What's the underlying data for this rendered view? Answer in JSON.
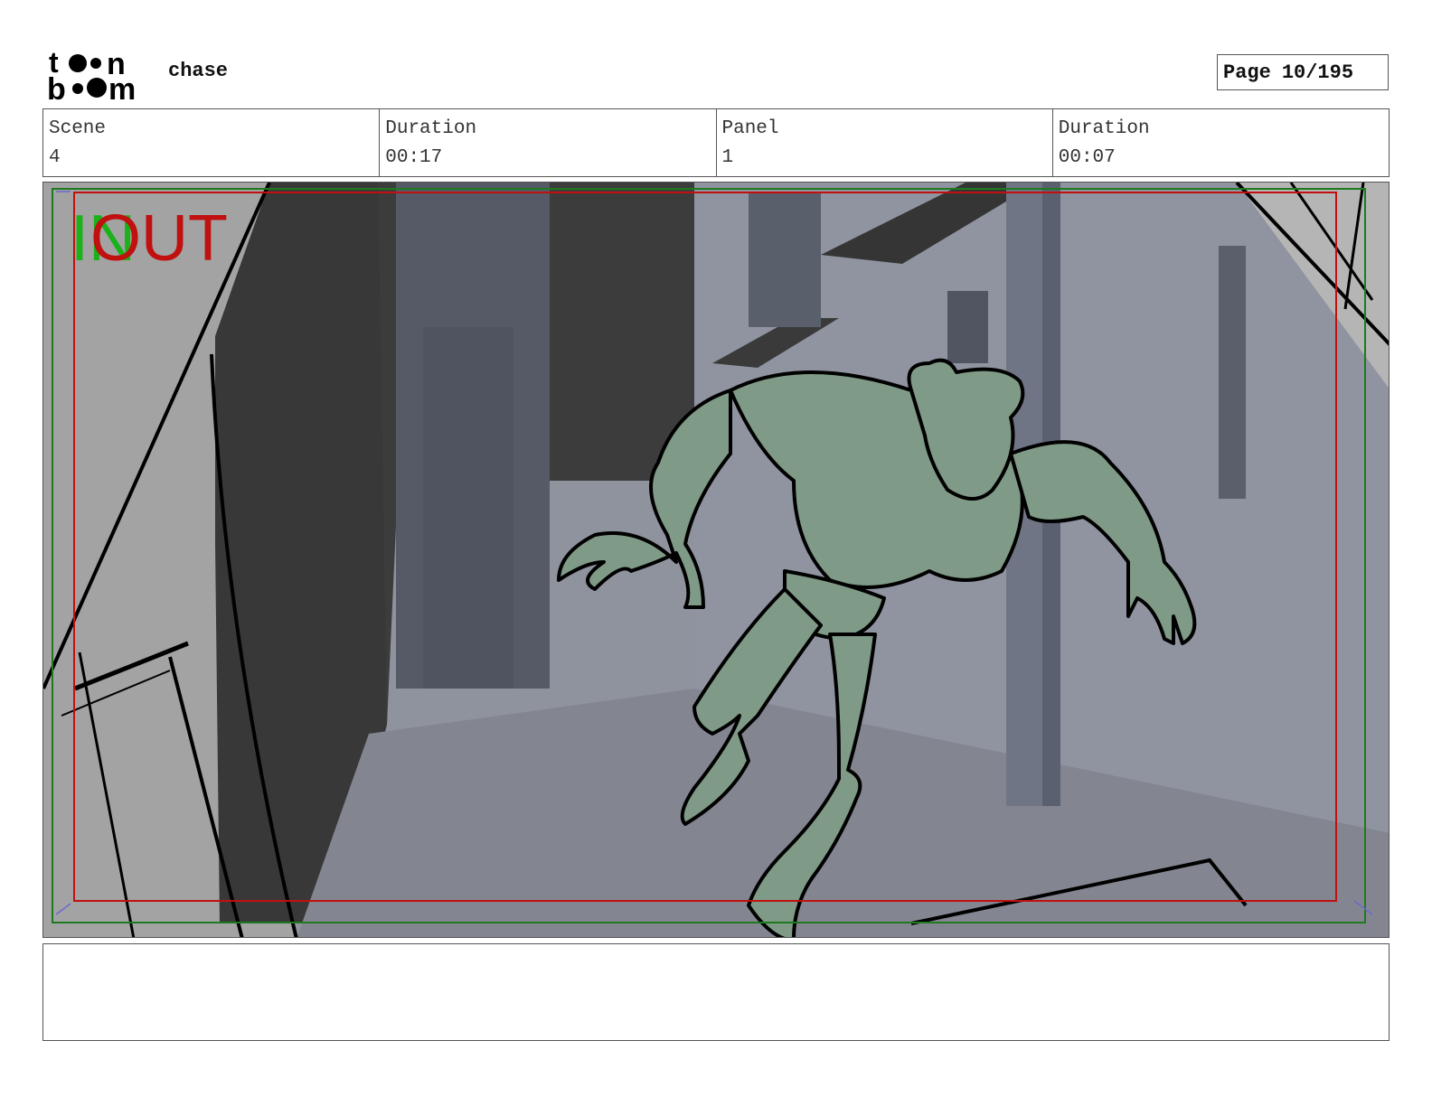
{
  "header": {
    "logo_text_top": "toon",
    "logo_text_bottom": "boom",
    "project_title": "chase",
    "page_label": "Page",
    "page_value": "10/195"
  },
  "info": {
    "scene_label": "Scene",
    "scene_value": "4",
    "scene_duration_label": "Duration",
    "scene_duration_value": "00:17",
    "panel_label": "Panel",
    "panel_value": "1",
    "panel_duration_label": "Duration",
    "panel_duration_value": "00:07"
  },
  "panel": {
    "in_label": "IN",
    "out_label": "OUT",
    "colors": {
      "in_frame": "#1e7a1e",
      "out_frame": "#c01010",
      "character_fill": "#7f9a86",
      "wall_light": "#8e939e",
      "wall_dark": "#3a3a3a",
      "floor": "#828690"
    }
  },
  "notes": {
    "text": ""
  }
}
